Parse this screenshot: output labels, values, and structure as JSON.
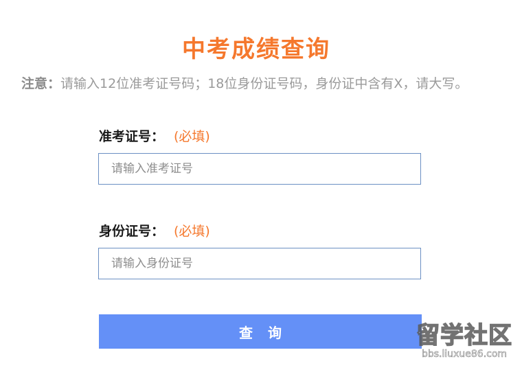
{
  "page": {
    "title": "中考成绩查询",
    "notice_label": "注意：",
    "notice_text": "请输入12位准考证号码；18位身份证号码，身份证中含有X，请大写。"
  },
  "form": {
    "exam_id": {
      "label": "准考证号：",
      "required": "(必填)",
      "placeholder": "请输入准考证号",
      "value": ""
    },
    "id_card": {
      "label": "身份证号：",
      "required": "(必填)",
      "placeholder": "请输入身份证号",
      "value": ""
    },
    "submit_label": "查询"
  },
  "watermark": {
    "main": "留学社区",
    "sub": "bbs.liuxue86.com"
  },
  "colors": {
    "title": "#f5782d",
    "button": "#6490f7",
    "input_border": "#6b8fc3"
  }
}
